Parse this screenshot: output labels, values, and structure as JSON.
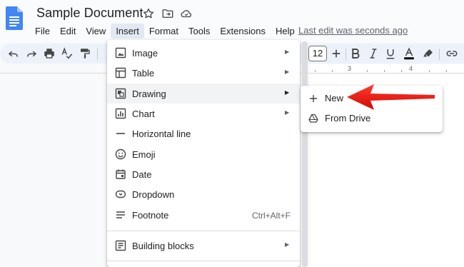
{
  "doc": {
    "title": "Sample Document",
    "last_edit": "Last edit was seconds ago"
  },
  "menubar": [
    {
      "label": "File"
    },
    {
      "label": "Edit"
    },
    {
      "label": "View"
    },
    {
      "label": "Insert",
      "active": true
    },
    {
      "label": "Format"
    },
    {
      "label": "Tools"
    },
    {
      "label": "Extensions"
    },
    {
      "label": "Help"
    }
  ],
  "toolbar": {
    "font_size": "12",
    "text_color_underline": "#000000"
  },
  "ruler": {
    "labels": [
      "3",
      "4"
    ]
  },
  "insert_menu": {
    "items": [
      {
        "label": "Image",
        "icon": "image-icon",
        "submenu": true
      },
      {
        "label": "Table",
        "icon": "table-icon",
        "submenu": true
      },
      {
        "label": "Drawing",
        "icon": "drawing-icon",
        "submenu": true,
        "highlighted": true
      },
      {
        "label": "Chart",
        "icon": "chart-icon",
        "submenu": true
      },
      {
        "label": "Horizontal line",
        "icon": "horizontal-line-icon"
      },
      {
        "label": "Emoji",
        "icon": "emoji-icon"
      },
      {
        "label": "Date",
        "icon": "date-icon"
      },
      {
        "label": "Dropdown",
        "icon": "dropdown-icon"
      },
      {
        "label": "Footnote",
        "icon": "footnote-icon",
        "shortcut": "Ctrl+Alt+F"
      },
      {
        "label": "Building blocks",
        "icon": "building-blocks-icon",
        "submenu": true
      }
    ]
  },
  "drawing_submenu": {
    "items": [
      {
        "label": "New",
        "icon": "plus-icon"
      },
      {
        "label": "From Drive",
        "icon": "drive-icon"
      }
    ]
  },
  "colors": {
    "accent_blue": "#4285f4",
    "annotation_red": "#e8120c",
    "menu_highlight": "#f1f3f4",
    "toolbar_bg": "#edf2fa"
  }
}
